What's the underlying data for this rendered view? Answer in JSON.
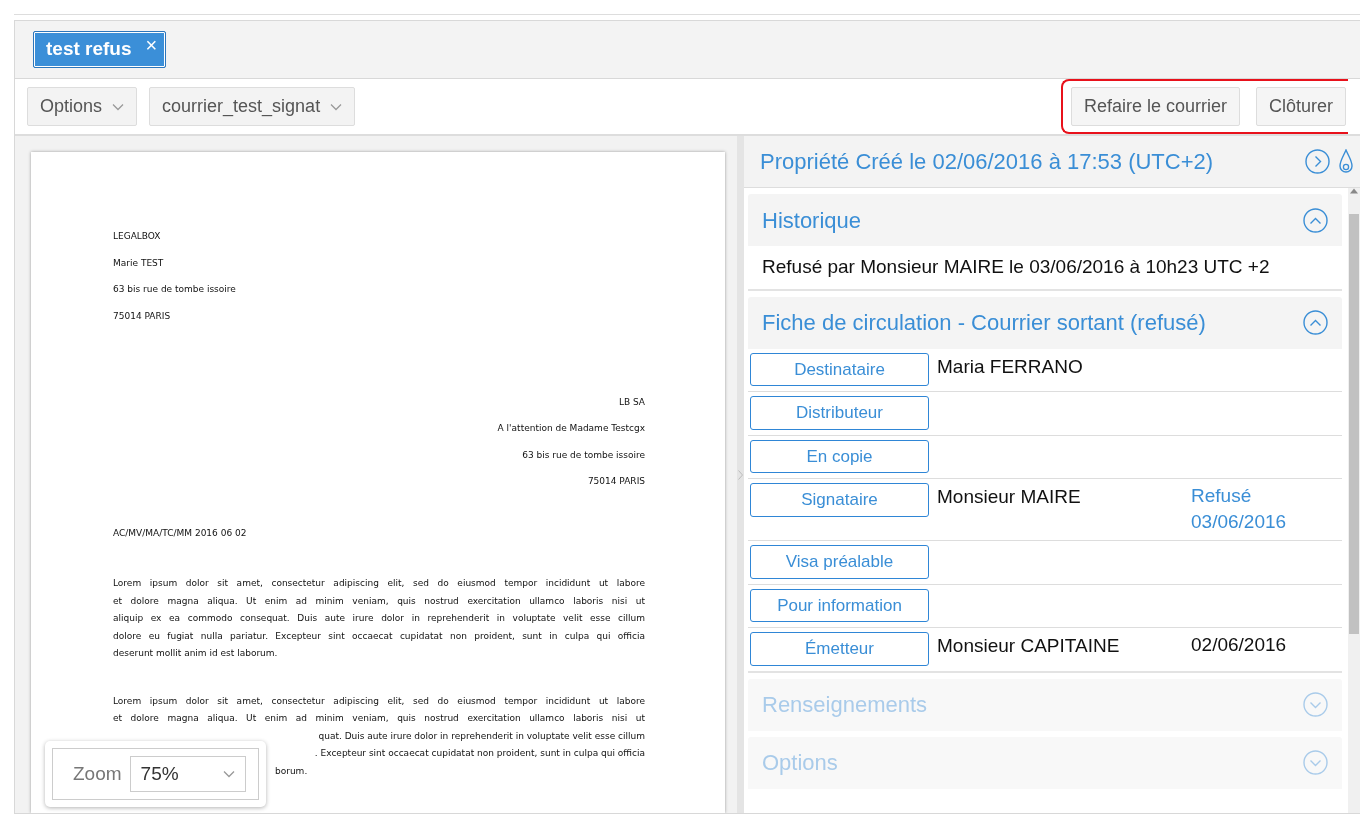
{
  "tabs": [
    {
      "label": "test refus",
      "selected": true,
      "close": "×"
    }
  ],
  "toolbar": {
    "dropdowns": [
      {
        "label": "Options"
      },
      {
        "label": "courrier_test_signat"
      }
    ],
    "actions": {
      "highlighted": true,
      "buttons": [
        {
          "label": "Refaire le courrier"
        },
        {
          "label": "Clôturer"
        }
      ]
    }
  },
  "document": {
    "sender": [
      "LEGALBOX",
      "Marie TEST",
      "63 bis rue de tombe issoire",
      "75014 PARIS"
    ],
    "recipient": [
      "LB SA",
      "A l'attention de Madame Testcgx",
      "63 bis rue de tombe issoire",
      "75014 PARIS"
    ],
    "reference": "AC/MV/MA/TC/MM 2016 06 02",
    "paragraphs": [
      {
        "lines": [
          {
            "kind": "full",
            "text": "Lorem ipsum dolor sit amet, consectetur adipiscing elit, sed do eiusmod tempor incididunt ut labore"
          },
          {
            "kind": "full",
            "text": "et dolore magna aliqua. Ut enim ad minim veniam, quis nostrud exercitation ullamco laboris nisi ut"
          },
          {
            "kind": "full",
            "text": "aliquip ex ea commodo consequat. Duis aute irure dolor in reprehenderit in voluptate velit esse cillum"
          },
          {
            "kind": "full",
            "text": "dolore eu fugiat nulla pariatur. Excepteur sint occaecat cupidatat non proident, sunt in culpa qui officia"
          },
          {
            "kind": "last",
            "text": "deserunt mollit anim id est laborum."
          }
        ]
      },
      {
        "lines": [
          {
            "kind": "full",
            "text": "Lorem ipsum dolor sit amet, consectetur adipiscing elit, sed do eiusmod tempor incididunt ut labore"
          },
          {
            "kind": "full",
            "text": "et dolore magna aliqua. Ut enim ad minim veniam, quis nostrud exercitation ullamco laboris nisi ut"
          },
          {
            "kind": "cut",
            "text": "quat. Duis aute irure dolor in reprehenderit in voluptate velit esse cillum"
          },
          {
            "kind": "cut",
            "text": ". Excepteur sint occaecat cupidatat non proident, sunt in culpa qui officia"
          },
          {
            "kind": "cut_last",
            "text": "borum."
          }
        ]
      }
    ]
  },
  "zoom": {
    "label": "Zoom",
    "value": "75%"
  },
  "properties": {
    "title": "Propriété Créé le 02/06/2016 à 17:53 (UTC+2)",
    "sections": [
      {
        "title": "Historique",
        "expanded": true,
        "disabled": false,
        "kind": "history",
        "entries": [
          "Refusé par Monsieur MAIRE le 03/06/2016 à 10h23 UTC +2"
        ]
      },
      {
        "title": "Fiche de circulation - Courrier sortant (refusé)",
        "expanded": true,
        "disabled": false,
        "kind": "flow",
        "rows": [
          {
            "role": "Destinataire",
            "name": "Maria FERRANO"
          },
          {
            "role": "Distributeur"
          },
          {
            "role": "En copie"
          },
          {
            "role": "Signataire",
            "name": "Monsieur MAIRE",
            "status": "Refusé 03/06/2016",
            "kind": "refused"
          },
          {
            "role": "Visa préalable"
          },
          {
            "role": "Pour information"
          },
          {
            "role": "Émetteur",
            "name": "Monsieur CAPITAINE",
            "status": "02/06/2016",
            "kind": "date"
          }
        ]
      },
      {
        "title": "Renseignements",
        "expanded": false,
        "disabled": true,
        "kind": "plain"
      },
      {
        "title": "Options",
        "expanded": false,
        "disabled": true,
        "kind": "plain"
      }
    ]
  }
}
